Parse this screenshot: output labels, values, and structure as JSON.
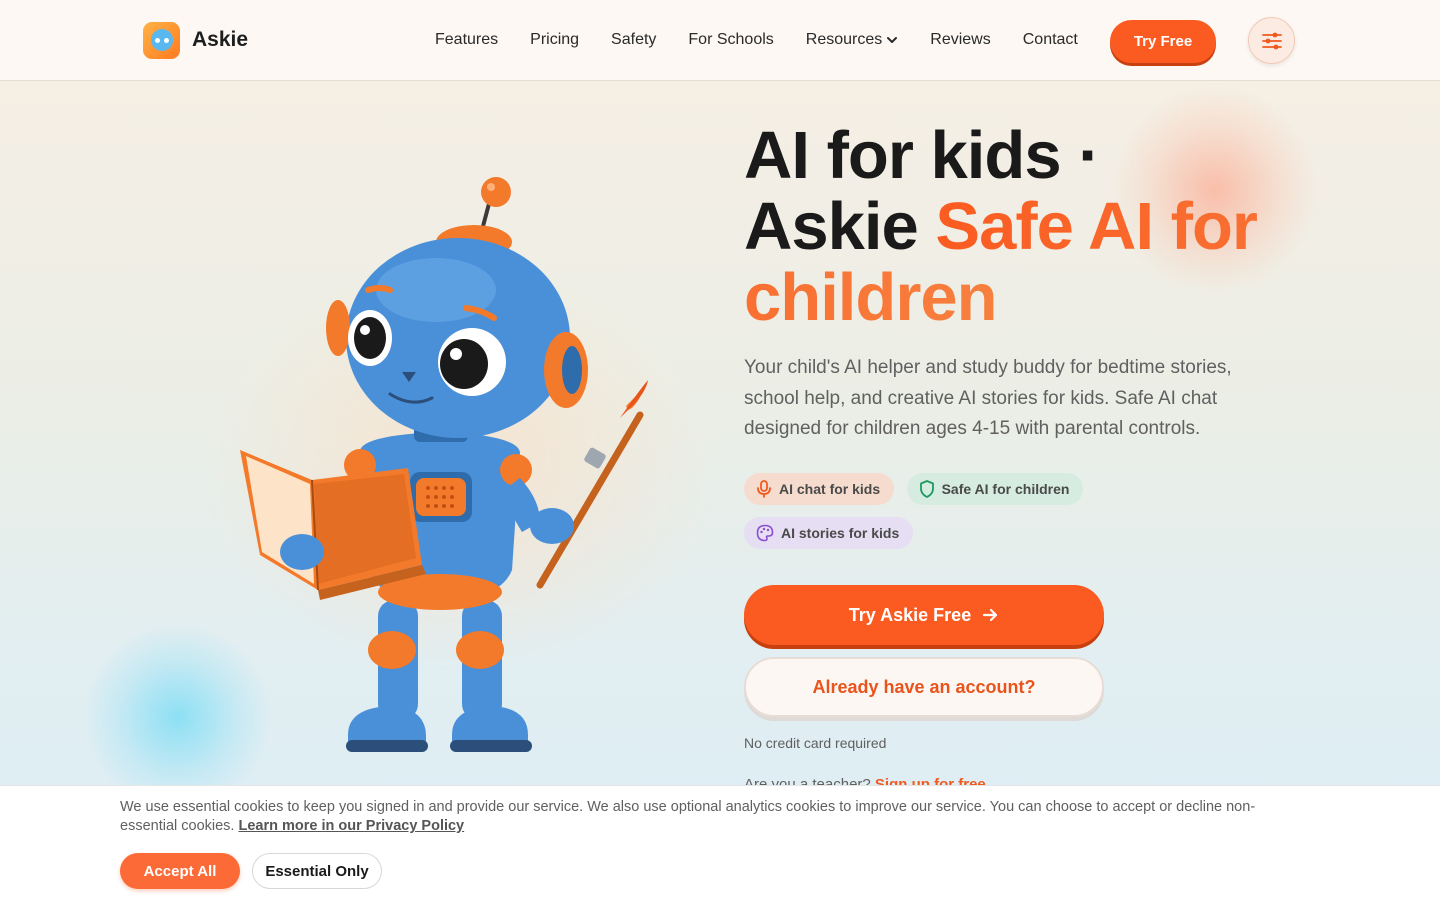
{
  "brand": {
    "name": "Askie"
  },
  "nav": {
    "items": [
      "Features",
      "Pricing",
      "Safety",
      "For Schools",
      "Resources",
      "Reviews",
      "Contact"
    ],
    "try_label": "Try Free"
  },
  "hero": {
    "headline_line1": "AI for kids ·",
    "headline_line2_plain": "Askie ",
    "headline_accent": "Safe AI for children",
    "subtext": "Your child's AI helper and study buddy for bedtime stories, school help, and creative AI stories for kids. Safe AI chat designed for children ages 4-15 with parental controls.",
    "chips": [
      {
        "label": "AI chat for kids",
        "icon": "mic-icon"
      },
      {
        "label": "Safe AI for children",
        "icon": "shield-icon"
      },
      {
        "label": "AI stories for kids",
        "icon": "palette-icon"
      }
    ],
    "cta_primary": "Try Askie Free",
    "cta_secondary": "Already have an account?",
    "no_card": "No credit card required",
    "teacher_prompt": "Are you a teacher?",
    "teacher_link": "Sign up for free"
  },
  "cookie": {
    "text": "We use essential cookies to keep you signed in and provide our service. We also use optional analytics cookies to improve our service. You can choose to accept or decline non-essential cookies.",
    "link": "Learn more in our Privacy Policy",
    "accept_label": "Accept All",
    "essential_label": "Essential Only"
  },
  "colors": {
    "accent": "#fb5b21",
    "robot_blue": "#4a90d9",
    "robot_orange": "#f37a2a"
  }
}
